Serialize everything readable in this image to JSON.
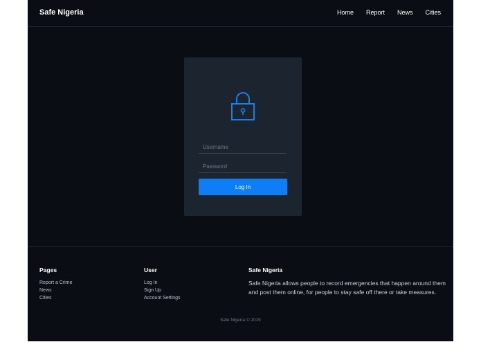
{
  "navbar": {
    "brand": "Safe Nigeria",
    "links": [
      "Home",
      "Report",
      "News",
      "Cities"
    ]
  },
  "login": {
    "icon": "lock-icon",
    "username_placeholder": "Username",
    "password_placeholder": "Password",
    "button_label": "Log In",
    "accent_color": "#0d7ef5"
  },
  "footer": {
    "pages": {
      "heading": "Pages",
      "links": [
        "Report a Crime",
        "News",
        "Cities"
      ]
    },
    "user": {
      "heading": "User",
      "links": [
        "Log In",
        "Sign Up",
        "Account Settings"
      ]
    },
    "about": {
      "heading": "Safe Nigeria",
      "text": "Safe Nigeria allows people to record emergencies that happen around them and post them online, for people to stay safe off there or take measures."
    },
    "copyright": "Safe Nigeria © 2019"
  }
}
